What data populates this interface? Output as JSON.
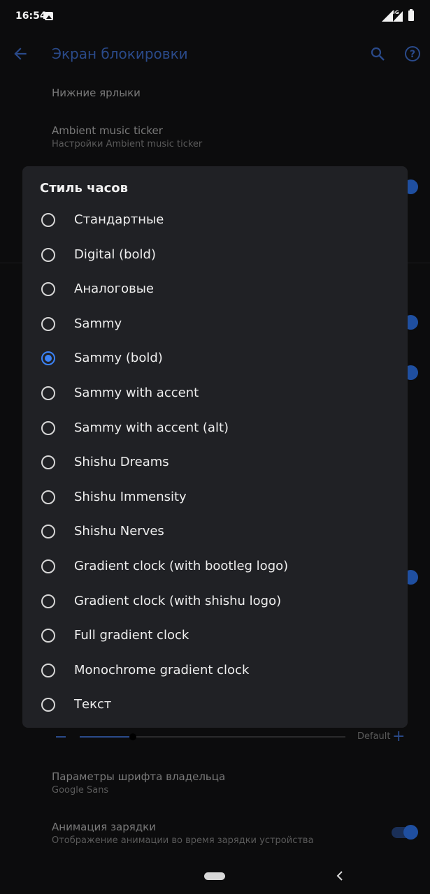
{
  "status_bar": {
    "time": "16:54",
    "network": "4G",
    "icons": [
      "image-icon",
      "signal-icon",
      "signal-4g-icon",
      "battery-icon"
    ]
  },
  "app_bar": {
    "title": "Экран блокировки",
    "icons": [
      "back-arrow-icon",
      "search-icon",
      "help-icon"
    ]
  },
  "background_list": {
    "item1_title": "Нижние ярлыки",
    "item2_title": "Ambient music ticker",
    "item2_subtitle": "Настройки Ambient music ticker",
    "slider": {
      "default_label": "Default",
      "value_fraction": 0.2
    },
    "item3_title": "Параметры шрифта владельца",
    "item3_subtitle": "Google Sans",
    "item4_title": "Анимация зарядки",
    "item4_subtitle": "Отображение анимации во время зарядки устройства"
  },
  "dialog": {
    "title": "Стиль часов",
    "selected_index": 4,
    "options": [
      "Стандартные",
      "Digital (bold)",
      "Аналоговые",
      "Sammy",
      "Sammy (bold)",
      "Sammy with accent",
      "Sammy with accent (alt)",
      "Shishu Dreams",
      "Shishu Immensity",
      "Shishu Nerves",
      "Gradient clock (with bootleg logo)",
      "Gradient clock (with shishu logo)",
      "Full gradient clock",
      "Monochrome gradient clock",
      "Текст"
    ]
  },
  "colors": {
    "accent": "#3b82f6",
    "dialog_bg": "#202125",
    "screen_bg": "#0c0c0d"
  }
}
